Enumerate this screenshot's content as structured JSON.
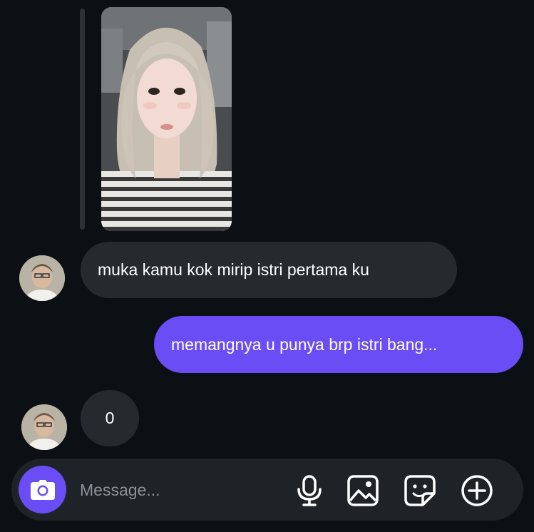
{
  "conversation": {
    "messages": [
      {
        "sender": "other",
        "text": "muka kamu kok mirip istri pertama ku"
      },
      {
        "sender": "me",
        "text": "memangnya u punya brp istri bang..."
      },
      {
        "sender": "other",
        "text": "0"
      }
    ]
  },
  "composer": {
    "placeholder": "Message...",
    "icons": [
      "camera-icon",
      "microphone-icon",
      "gallery-icon",
      "sticker-icon",
      "add-icon"
    ]
  },
  "colors": {
    "background": "#0c1014",
    "incoming_bubble": "#262a2e",
    "outgoing_bubble": "#6a4df5",
    "accent": "#6a4df5"
  }
}
